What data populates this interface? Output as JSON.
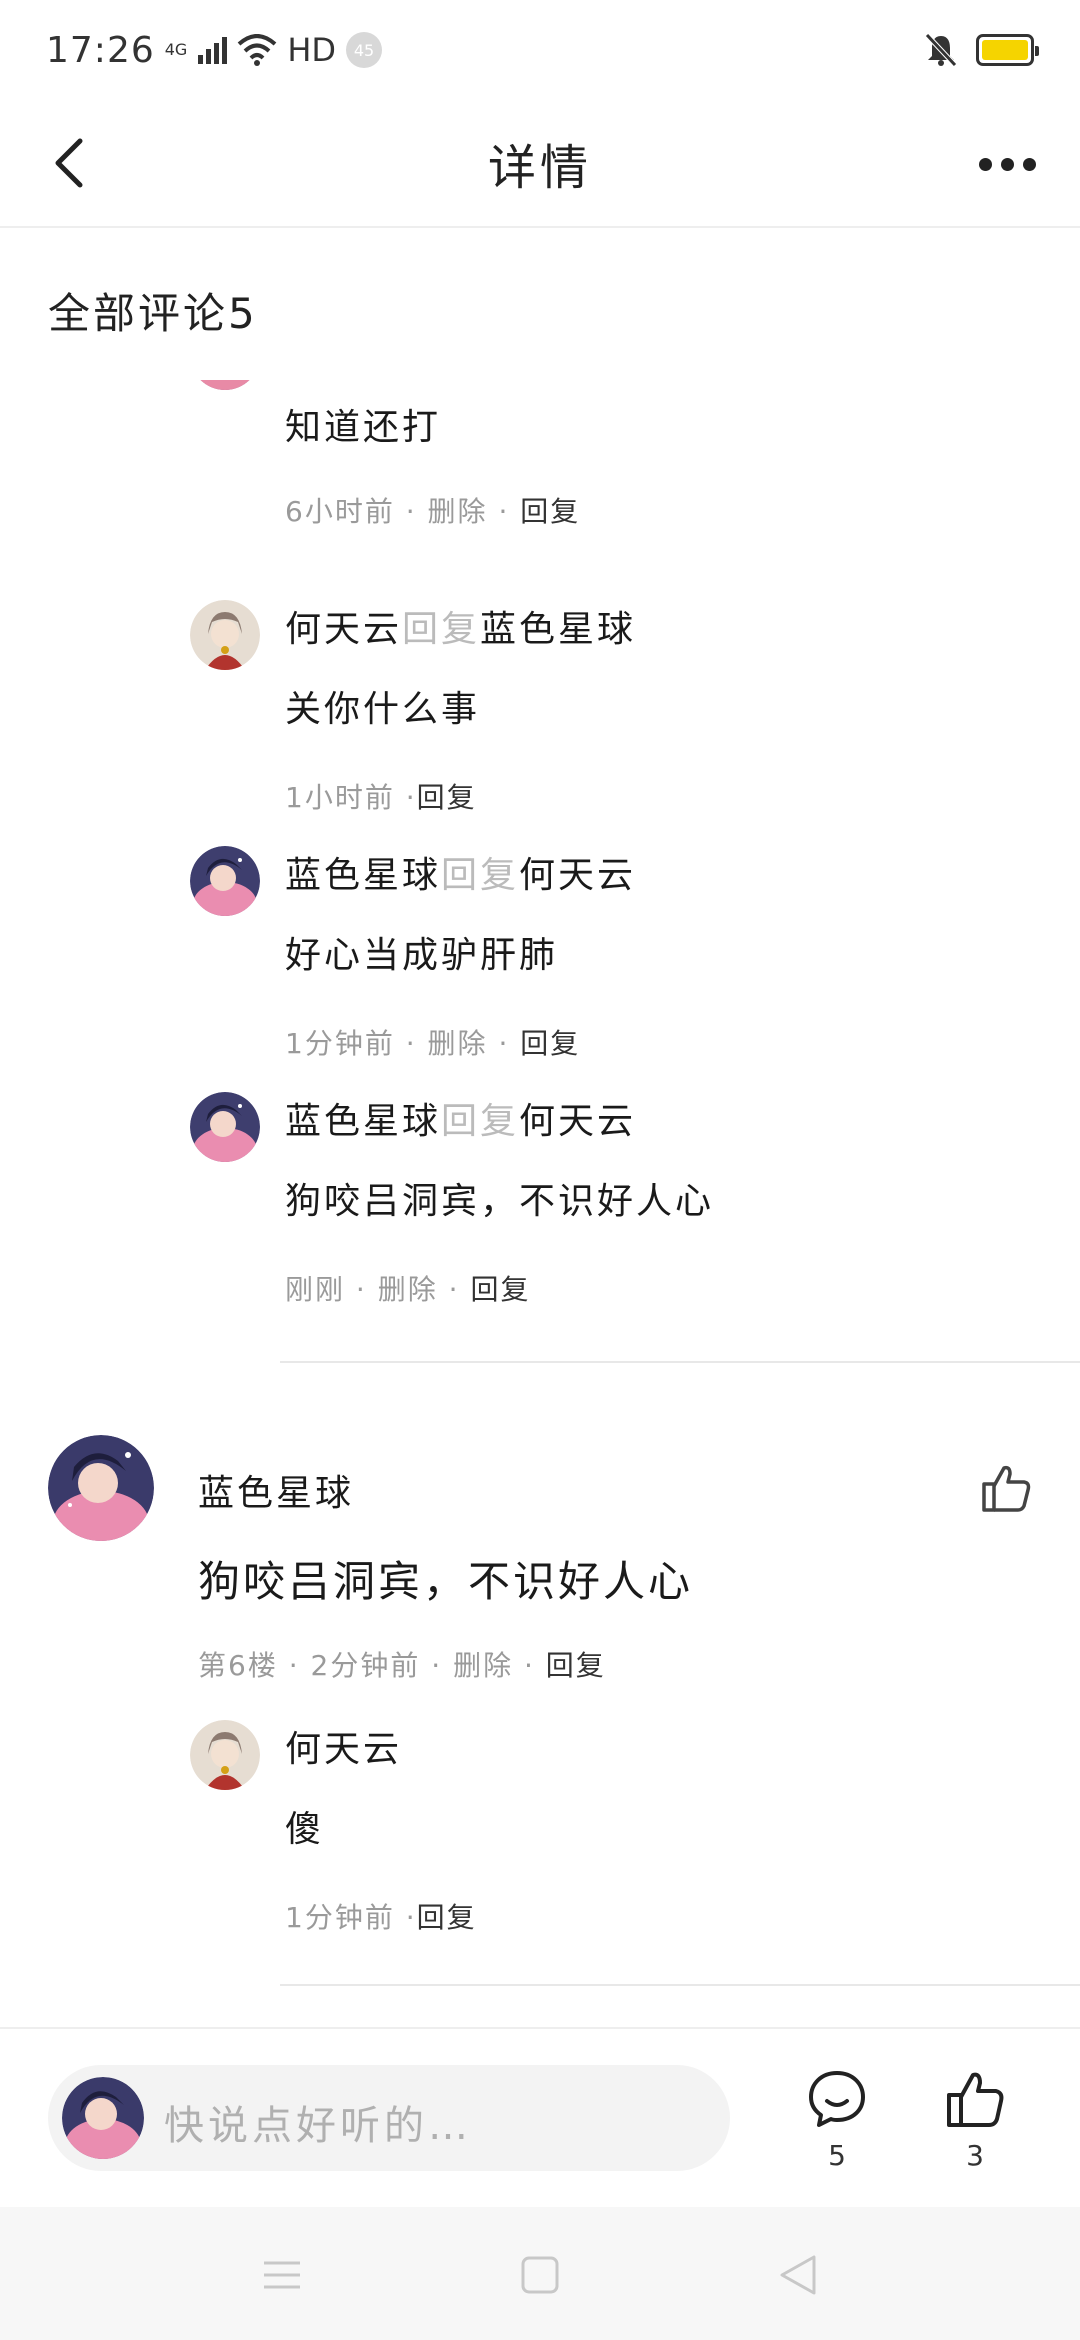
{
  "status": {
    "time": "17:26",
    "network": "4G",
    "hd": "HD",
    "badge": "45"
  },
  "header": {
    "title": "详情"
  },
  "section_title": "全部评论5",
  "thread1": {
    "partial_text": "知道还打",
    "partial_meta": {
      "time": "6小时前",
      "delete": "删除",
      "reply": "回复"
    },
    "replies": [
      {
        "author": "何天云",
        "reply_word": "回复",
        "target": "蓝色星球",
        "text": "关你什么事",
        "time": "1小时前",
        "delete": "",
        "reply": "回复"
      },
      {
        "author": "蓝色星球",
        "reply_word": "回复",
        "target": "何天云",
        "text": "好心当成驴肝肺",
        "time": "1分钟前",
        "delete": "删除",
        "reply": "回复"
      },
      {
        "author": "蓝色星球",
        "reply_word": "回复",
        "target": "何天云",
        "text": "狗咬吕洞宾，不识好人心",
        "time": "刚刚",
        "delete": "删除",
        "reply": "回复"
      }
    ]
  },
  "comment6": {
    "author": "蓝色星球",
    "text": "狗咬吕洞宾，不识好人心",
    "floor": "第6楼",
    "time": "2分钟前",
    "delete": "删除",
    "reply": "回复",
    "sub_reply": {
      "author": "何天云",
      "text": "傻",
      "time": "1分钟前",
      "reply": "回复"
    }
  },
  "bottom": {
    "placeholder": "快说点好听的…",
    "comment_count": "5",
    "like_count": "3"
  },
  "colors": {
    "accent": "#f5d400",
    "muted": "#9a9a9a"
  }
}
